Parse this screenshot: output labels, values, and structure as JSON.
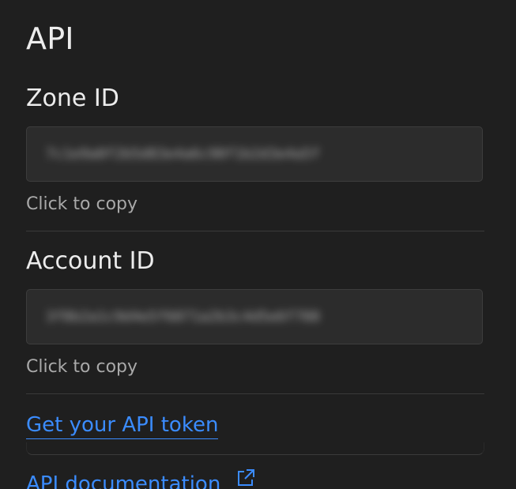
{
  "panel": {
    "title": "API"
  },
  "zone": {
    "label": "Zone ID",
    "value": "7c1e9a0f2b5d83e4a6c90f1b2d3e4a5f",
    "hint": "Click to copy"
  },
  "account": {
    "label": "Account ID",
    "value": "3f8b2a1c9d4e5f6071a2b3c4d5e6f708",
    "hint": "Click to copy"
  },
  "links": {
    "api_token": "Get your API token",
    "api_docs": "API documentation",
    "api_docs_icon": "external-link-icon"
  },
  "colors": {
    "background": "#1f1f1f",
    "link": "#3b8cff",
    "box": "#2c2c2c"
  }
}
